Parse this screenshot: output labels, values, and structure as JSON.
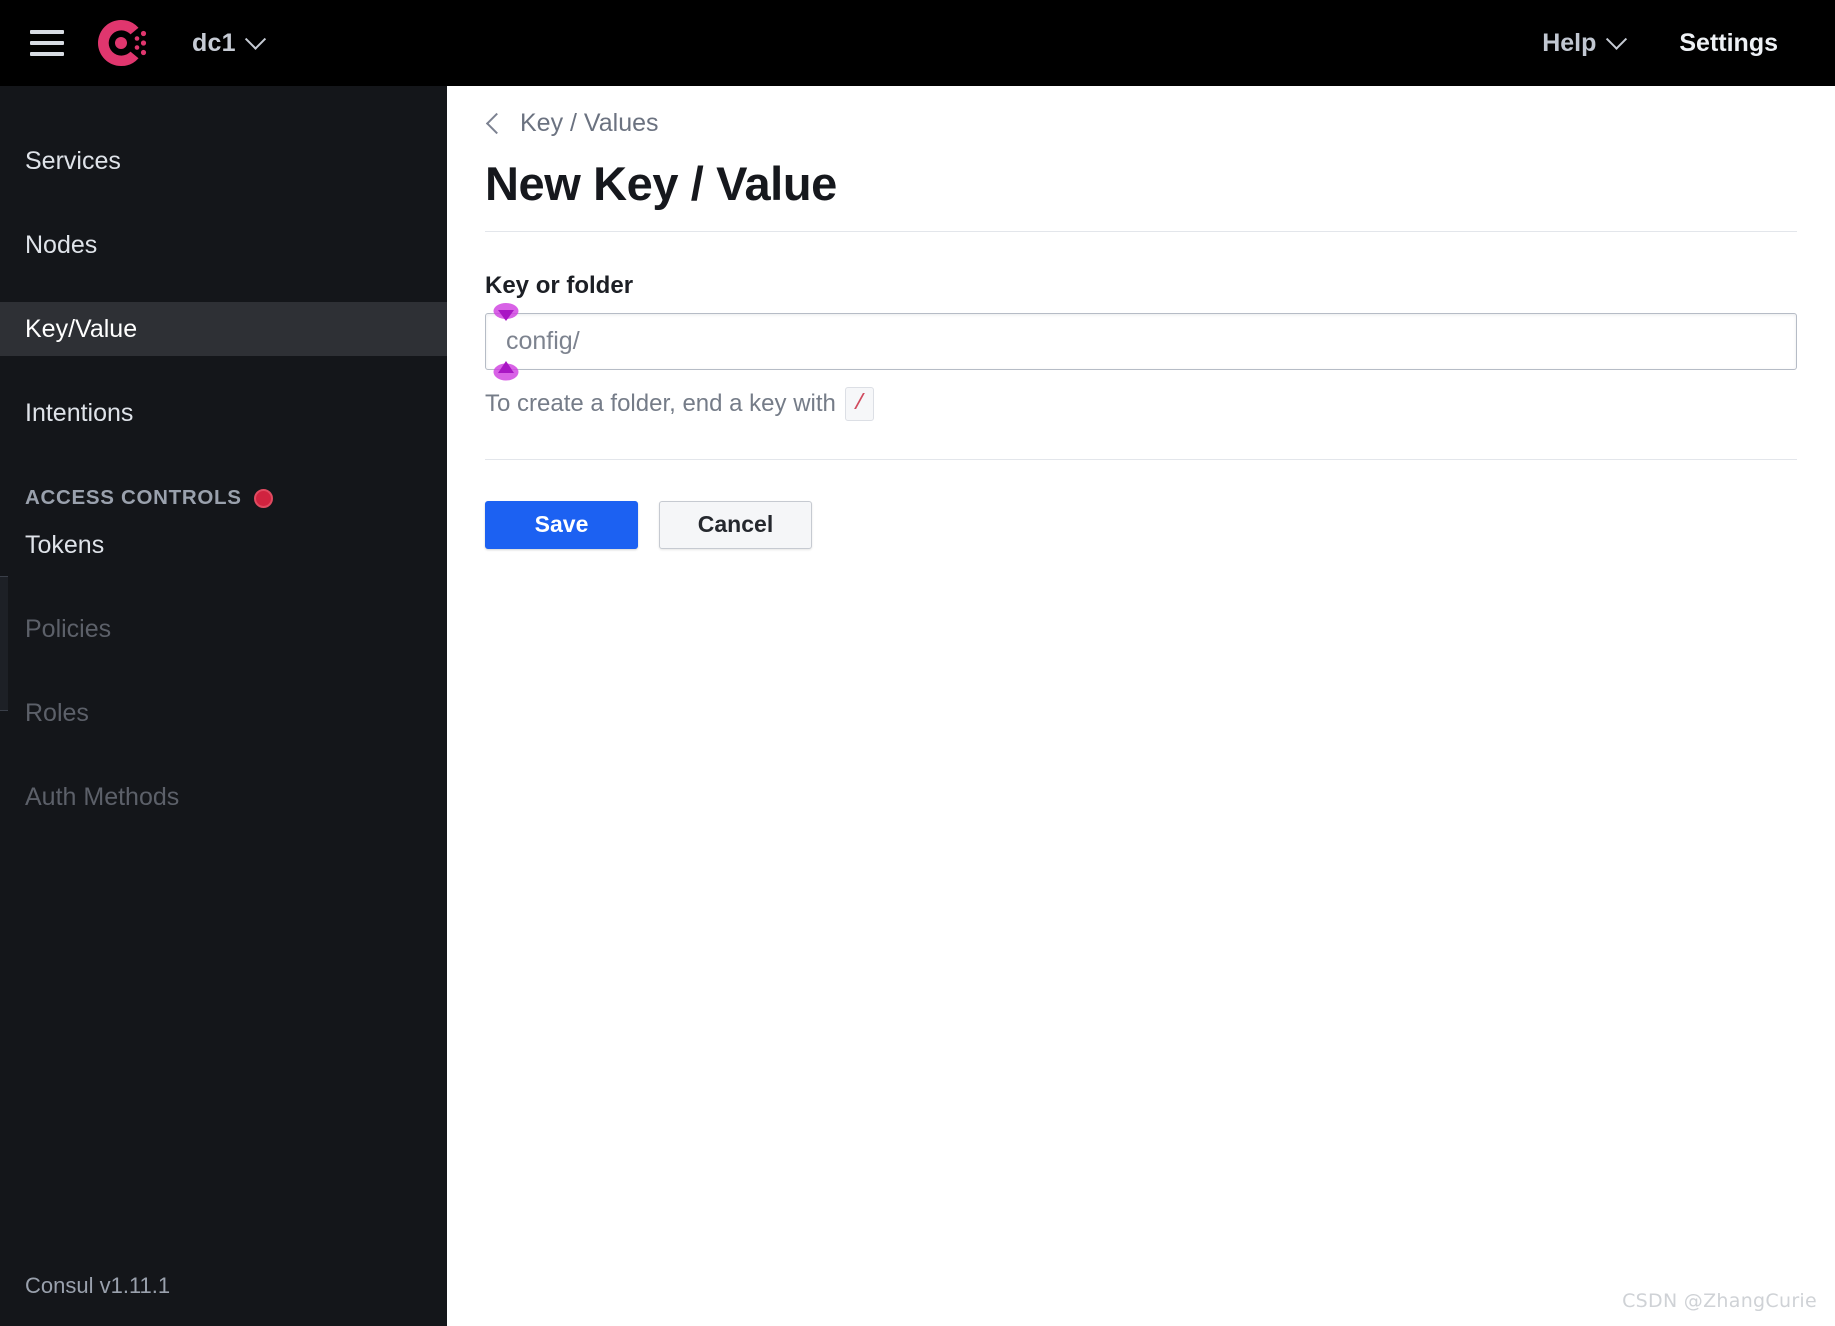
{
  "header": {
    "menu_icon": "hamburger-icon",
    "logo_icon": "consul-logo-icon",
    "datacenter": "dc1",
    "datacenter_chevron": "chevron-down-icon",
    "help": "Help",
    "help_chevron": "chevron-down-icon",
    "settings": "Settings",
    "background": "#000000",
    "logo_color": "#e0366e"
  },
  "sidebar": {
    "background": "#14161a",
    "active_background": "#2e3035",
    "items": [
      {
        "label": "Services",
        "state": "normal"
      },
      {
        "label": "Nodes",
        "state": "normal"
      },
      {
        "label": "Key/Value",
        "state": "active"
      },
      {
        "label": "Intentions",
        "state": "normal"
      }
    ],
    "section": {
      "label": "ACCESS CONTROLS",
      "status_dot": "acl-status-dot",
      "status_color": "#d0233f"
    },
    "acl_items": [
      {
        "label": "Tokens",
        "state": "normal"
      },
      {
        "label": "Policies",
        "state": "disabled"
      },
      {
        "label": "Roles",
        "state": "disabled"
      },
      {
        "label": "Auth Methods",
        "state": "disabled"
      }
    ],
    "footer": "Consul v1.11.1"
  },
  "main": {
    "breadcrumb": {
      "back_icon": "chevron-left-icon",
      "label": "Key / Values"
    },
    "title": "New Key / Value",
    "form": {
      "field_label": "Key or folder",
      "input_value": "",
      "input_placeholder": "config/",
      "help_prefix": "To create a folder, end a key with",
      "help_code": "/",
      "code_color": "#d04a5e",
      "selection_handles": {
        "fill": "#c22ad0",
        "glow": "#d14ae0"
      }
    },
    "actions": {
      "save_label": "Save",
      "save_color": "#1c61f2",
      "cancel_label": "Cancel"
    }
  },
  "watermark": "CSDN @ZhangCurie"
}
